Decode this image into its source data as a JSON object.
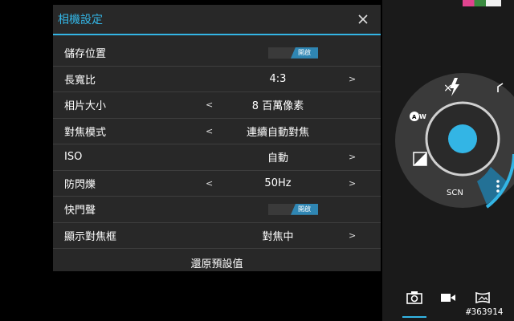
{
  "dialog": {
    "title": "相機設定",
    "rows": [
      {
        "label": "儲存位置",
        "type": "toggle",
        "value": "開啟"
      },
      {
        "label": "長寬比",
        "type": "select",
        "value": "4:3",
        "left_arrow": "",
        "right_arrow": ">"
      },
      {
        "label": "相片大小",
        "type": "select",
        "value": "8 百萬像素",
        "left_arrow": "<",
        "right_arrow": ""
      },
      {
        "label": "對焦模式",
        "type": "select",
        "value": "連續自動對焦",
        "left_arrow": "<",
        "right_arrow": ""
      },
      {
        "label": "ISO",
        "type": "select",
        "value": "自動",
        "left_arrow": "",
        "right_arrow": ">"
      },
      {
        "label": "防閃爍",
        "type": "select",
        "value": "50Hz",
        "left_arrow": "<",
        "right_arrow": ">"
      },
      {
        "label": "快門聲",
        "type": "toggle",
        "value": "開啟"
      },
      {
        "label": "顯示對焦框",
        "type": "select",
        "value": "對焦中",
        "left_arrow": "",
        "right_arrow": ">"
      }
    ],
    "reset_label": "還原預設值"
  },
  "camera_controls": {
    "scene_label": "SCN",
    "auto_wb_label": "AW",
    "accent_color": "#33b5e5"
  },
  "watermark": "#363914"
}
